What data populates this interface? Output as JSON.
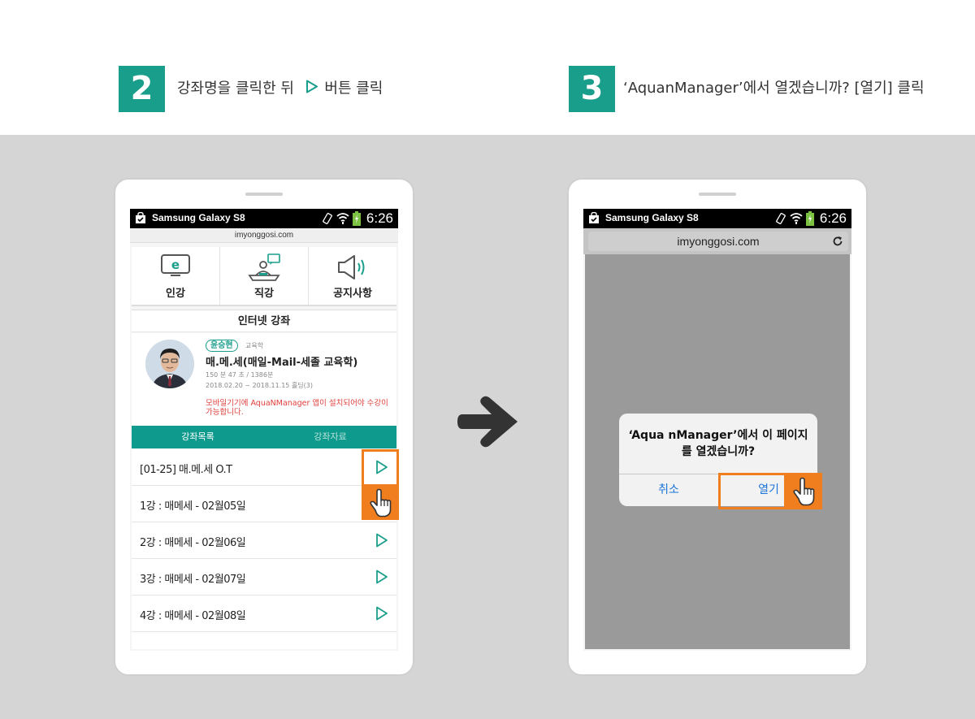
{
  "steps": [
    {
      "number": "2",
      "text_before": "강좌명을 클릭한 뒤",
      "text_after": "버튼 클릭"
    },
    {
      "number": "3",
      "text": "‘AquanManager’에서 열겠습니까? [열기] 클릭"
    }
  ],
  "phone": {
    "device_name": "Samsung Galaxy S8",
    "time": "6:26"
  },
  "left_screen": {
    "url": "imyonggosi.com",
    "menu": [
      {
        "label": "인강",
        "icon": "monitor-e-icon"
      },
      {
        "label": "직강",
        "icon": "lecture-podium-icon"
      },
      {
        "label": "공지사항",
        "icon": "speaker-icon"
      }
    ],
    "section_title": "인터넷 강좌",
    "lecture": {
      "teacher": "윤승현",
      "teacher_subject": "교육학",
      "course_name": "매.메.세(매일-Mail-세졸 교육학)",
      "duration": "150 분 47 초 / 1386분",
      "period": "2018.02.20 ~ 2018.11.15 홀딩(3)",
      "notice": "모바일기기에 AquaNManager 앱이 설치되어야 수강이 가능합니다."
    },
    "tabs": [
      "강좌목록",
      "강좌자료"
    ],
    "rows": [
      {
        "label": "[01-25] 매.메.세 O.T",
        "has_play": true
      },
      {
        "label": "1강 : 매메세 - 02월05일",
        "has_play": false
      },
      {
        "label": "2강 : 매메세 - 02월06일",
        "has_play": true
      },
      {
        "label": "3강 : 매메세 - 02월07일",
        "has_play": true
      },
      {
        "label": "4강 : 매메세 - 02월08일",
        "has_play": true
      }
    ]
  },
  "right_screen": {
    "url": "imyonggosi.com",
    "dialog": {
      "message_line1": "‘Aqua nManager’에서 이 페이지",
      "message_line2": "를 열겠습니까?",
      "cancel_label": "취소",
      "open_label": "열기"
    }
  },
  "colors": {
    "accent": "#1a9e8c",
    "highlight": "#f07d1e",
    "notice_red": "#e0403c",
    "ios_blue": "#1a73d9"
  }
}
